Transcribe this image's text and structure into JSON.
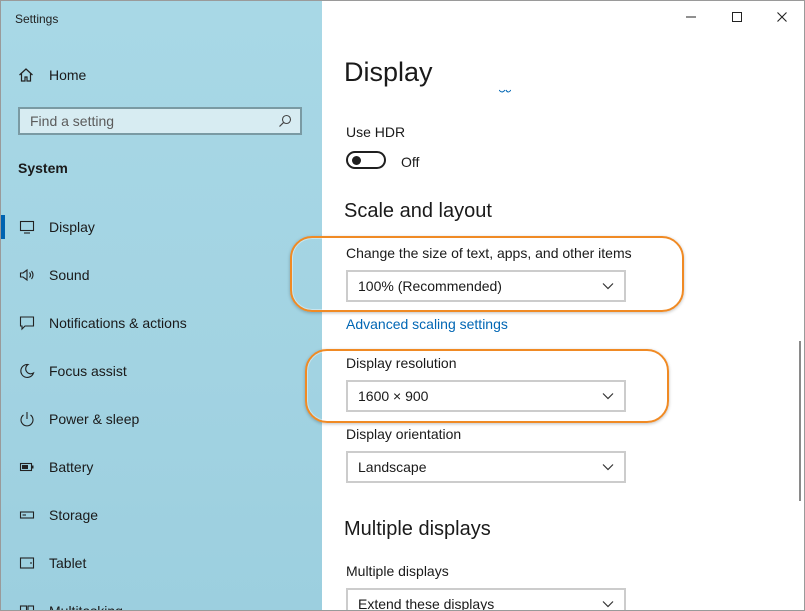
{
  "window": {
    "title": "Settings"
  },
  "sidebar": {
    "home_label": "Home",
    "search_placeholder": "Find a setting",
    "section_title": "System",
    "items": [
      {
        "label": "Display",
        "icon": "monitor-icon",
        "active": true
      },
      {
        "label": "Sound",
        "icon": "speaker-icon"
      },
      {
        "label": "Notifications & actions",
        "icon": "notification-icon"
      },
      {
        "label": "Focus assist",
        "icon": "moon-icon"
      },
      {
        "label": "Power & sleep",
        "icon": "power-icon"
      },
      {
        "label": "Battery",
        "icon": "battery-icon"
      },
      {
        "label": "Storage",
        "icon": "storage-icon"
      },
      {
        "label": "Tablet",
        "icon": "tablet-icon"
      },
      {
        "label": "Multitasking",
        "icon": "multitasking-icon"
      }
    ]
  },
  "main": {
    "title": "Display",
    "hdr_label": "Use HDR",
    "hdr_state": "Off",
    "scale_heading": "Scale and layout",
    "scale_label": "Change the size of text, apps, and other items",
    "scale_value": "100% (Recommended)",
    "advanced_link": "Advanced scaling settings",
    "resolution_label": "Display resolution",
    "resolution_value": "1600 × 900",
    "orientation_label": "Display orientation",
    "orientation_value": "Landscape",
    "multi_heading": "Multiple displays",
    "multi_label": "Multiple displays",
    "multi_value": "Extend these displays"
  },
  "colors": {
    "accent": "#0063b1",
    "link": "#0066b4",
    "highlight": "#f08a24",
    "sidebar_bg": "#a6d6e4"
  }
}
